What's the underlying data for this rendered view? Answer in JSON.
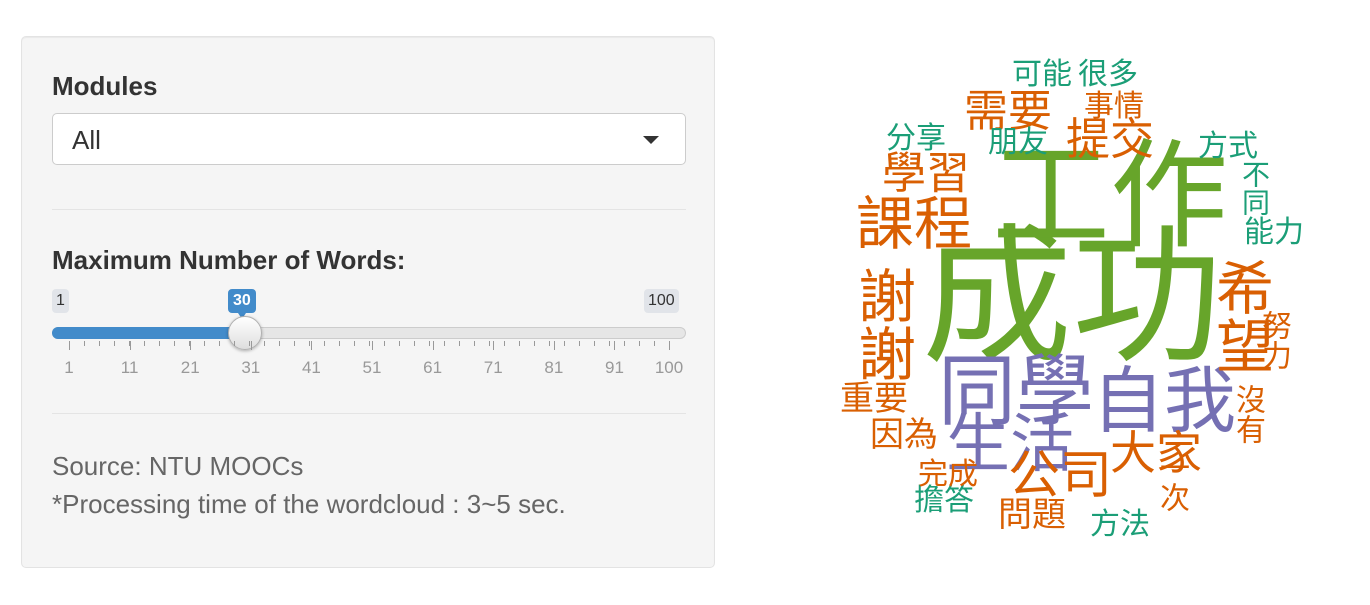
{
  "sidebar": {
    "modules_label": "Modules",
    "modules_value": "All",
    "slider": {
      "label": "Maximum Number of Words:",
      "min_label": "1",
      "max_label": "100",
      "value_label": "30",
      "value": 30,
      "min": 1,
      "max": 100,
      "ticks": [
        "1",
        "11",
        "21",
        "31",
        "41",
        "51",
        "61",
        "71",
        "81",
        "91",
        "100"
      ]
    },
    "source_text": "Source: NTU MOOCs",
    "processing_text": "*Processing time of the wordcloud : 3~5 sec."
  },
  "wordcloud": {
    "colors": {
      "green": "#67a52a",
      "orange": "#d95f02",
      "purple": "#7570b3",
      "teal": "#1b9e77"
    },
    "words": [
      "成功",
      "工作",
      "同學",
      "自我",
      "生活",
      "謝謝",
      "課程",
      "希望",
      "公司",
      "大家",
      "學習",
      "需要",
      "提交",
      "事情",
      "可能",
      "很多",
      "朋友",
      "分享",
      "方式",
      "不同",
      "能力",
      "努力",
      "沒有",
      "一次",
      "問題",
      "方法",
      "擔答",
      "完成",
      "因為",
      "重要"
    ]
  }
}
